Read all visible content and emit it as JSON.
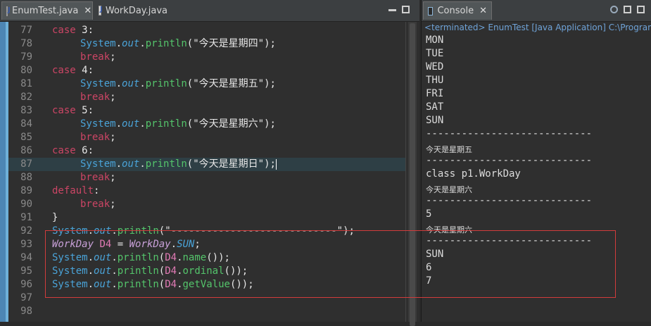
{
  "editor": {
    "tabs": [
      {
        "label": "EnumTest.java",
        "active": true
      },
      {
        "label": "WorkDay.java",
        "active": false
      }
    ],
    "close_glyph": "✕",
    "lines": [
      {
        "n": "77",
        "parts": [
          [
            "kw",
            "case"
          ],
          [
            "num",
            " 3"
          ],
          [
            "",
            ":"
          ]
        ],
        "indent": 1
      },
      {
        "n": "78",
        "parts": [
          [
            "cls",
            "System"
          ],
          [
            "",
            "."
          ],
          [
            "fld",
            "out"
          ],
          [
            "",
            "."
          ],
          [
            "mth",
            "println"
          ],
          [
            "",
            "("
          ],
          [
            "str",
            "\"今天是星期四\""
          ],
          [
            "",
            ");"
          ]
        ],
        "indent": 2
      },
      {
        "n": "79",
        "parts": [
          [
            "kw",
            "break"
          ],
          [
            "",
            ";"
          ]
        ],
        "indent": 2
      },
      {
        "n": "80",
        "parts": [
          [
            "kw",
            "case"
          ],
          [
            "num",
            " 4"
          ],
          [
            "",
            ":"
          ]
        ],
        "indent": 1
      },
      {
        "n": "81",
        "parts": [
          [
            "cls",
            "System"
          ],
          [
            "",
            "."
          ],
          [
            "fld",
            "out"
          ],
          [
            "",
            "."
          ],
          [
            "mth",
            "println"
          ],
          [
            "",
            "("
          ],
          [
            "str",
            "\"今天是星期五\""
          ],
          [
            "",
            ");"
          ]
        ],
        "indent": 2
      },
      {
        "n": "82",
        "parts": [
          [
            "kw",
            "break"
          ],
          [
            "",
            ";"
          ]
        ],
        "indent": 2
      },
      {
        "n": "83",
        "parts": [
          [
            "kw",
            "case"
          ],
          [
            "num",
            " 5"
          ],
          [
            "",
            ":"
          ]
        ],
        "indent": 1
      },
      {
        "n": "84",
        "parts": [
          [
            "cls",
            "System"
          ],
          [
            "",
            "."
          ],
          [
            "fld",
            "out"
          ],
          [
            "",
            "."
          ],
          [
            "mth",
            "println"
          ],
          [
            "",
            "("
          ],
          [
            "str",
            "\"今天是星期六\""
          ],
          [
            "",
            ");"
          ]
        ],
        "indent": 2
      },
      {
        "n": "85",
        "parts": [
          [
            "kw",
            "break"
          ],
          [
            "",
            ";"
          ]
        ],
        "indent": 2
      },
      {
        "n": "86",
        "parts": [
          [
            "kw",
            "case"
          ],
          [
            "num",
            " 6"
          ],
          [
            "",
            ":"
          ]
        ],
        "indent": 1
      },
      {
        "n": "87",
        "parts": [
          [
            "cls",
            "System"
          ],
          [
            "",
            "."
          ],
          [
            "fld",
            "out"
          ],
          [
            "",
            "."
          ],
          [
            "mth",
            "println"
          ],
          [
            "",
            "("
          ],
          [
            "str",
            "\"今天是星期日\""
          ],
          [
            "",
            ");"
          ]
        ],
        "indent": 2,
        "current": true
      },
      {
        "n": "88",
        "parts": [
          [
            "kw",
            "break"
          ],
          [
            "",
            ";"
          ]
        ],
        "indent": 2
      },
      {
        "n": "89",
        "parts": [
          [
            "kw",
            "default"
          ],
          [
            "",
            ":"
          ]
        ],
        "indent": 1
      },
      {
        "n": "90",
        "parts": [
          [
            "kw",
            "break"
          ],
          [
            "",
            ";"
          ]
        ],
        "indent": 2
      },
      {
        "n": "91",
        "parts": [
          [
            "",
            "}"
          ]
        ],
        "indent": 1
      },
      {
        "n": "92",
        "parts": [
          [
            "cls",
            "System"
          ],
          [
            "",
            "."
          ],
          [
            "fld",
            "out"
          ],
          [
            "",
            "."
          ],
          [
            "mth",
            "println"
          ],
          [
            "",
            "("
          ],
          [
            "str",
            "\"----------------------------\""
          ],
          [
            "",
            ");"
          ]
        ],
        "indent": 1
      },
      {
        "n": "93",
        "parts": [
          [
            "typ",
            "WorkDay"
          ],
          [
            "",
            ""
          ],
          [
            "var",
            " D4"
          ],
          [
            "",
            " = "
          ],
          [
            "typ",
            "WorkDay"
          ],
          [
            "",
            "."
          ],
          [
            "fld",
            "SUN"
          ],
          [
            "",
            ";"
          ]
        ],
        "indent": 1
      },
      {
        "n": "94",
        "parts": [
          [
            "cls",
            "System"
          ],
          [
            "",
            "."
          ],
          [
            "fld",
            "out"
          ],
          [
            "",
            "."
          ],
          [
            "mth",
            "println"
          ],
          [
            "",
            "("
          ],
          [
            "var",
            "D4"
          ],
          [
            "",
            "."
          ],
          [
            "mth",
            "name"
          ],
          [
            "",
            "());"
          ]
        ],
        "indent": 1
      },
      {
        "n": "95",
        "parts": [
          [
            "cls",
            "System"
          ],
          [
            "",
            "."
          ],
          [
            "fld",
            "out"
          ],
          [
            "",
            "."
          ],
          [
            "mth",
            "println"
          ],
          [
            "",
            "("
          ],
          [
            "var",
            "D4"
          ],
          [
            "",
            "."
          ],
          [
            "mth",
            "ordinal"
          ],
          [
            "",
            "());"
          ]
        ],
        "indent": 1
      },
      {
        "n": "96",
        "parts": [
          [
            "cls",
            "System"
          ],
          [
            "",
            "."
          ],
          [
            "fld",
            "out"
          ],
          [
            "",
            "."
          ],
          [
            "mth",
            "println"
          ],
          [
            "",
            "("
          ],
          [
            "var",
            "D4"
          ],
          [
            "",
            "."
          ],
          [
            "mth",
            "getValue"
          ],
          [
            "",
            "());"
          ]
        ],
        "indent": 1
      },
      {
        "n": "97",
        "parts": [],
        "indent": 0
      },
      {
        "n": "98",
        "parts": [],
        "indent": 0
      }
    ]
  },
  "console": {
    "tab_label": "Console",
    "close_glyph": "✕",
    "terminated_text": "<terminated> EnumTest [Java Application] C:\\Program",
    "output": [
      {
        "text": "MON",
        "cjk": false
      },
      {
        "text": "TUE",
        "cjk": false
      },
      {
        "text": "WED",
        "cjk": false
      },
      {
        "text": "THU",
        "cjk": false
      },
      {
        "text": "FRI",
        "cjk": false
      },
      {
        "text": "SAT",
        "cjk": false
      },
      {
        "text": "SUN",
        "cjk": false
      },
      {
        "text": "----------------------------",
        "cjk": false
      },
      {
        "text": "今天是星期五",
        "cjk": true
      },
      {
        "text": "----------------------------",
        "cjk": false
      },
      {
        "text": "class p1.WorkDay",
        "cjk": false
      },
      {
        "text": "今天是星期六",
        "cjk": true
      },
      {
        "text": "----------------------------",
        "cjk": false
      },
      {
        "text": "5",
        "cjk": false
      },
      {
        "text": "今天是星期六",
        "cjk": true
      },
      {
        "text": "----------------------------",
        "cjk": false
      },
      {
        "text": "SUN",
        "cjk": false
      },
      {
        "text": "6",
        "cjk": false
      },
      {
        "text": "7",
        "cjk": false
      }
    ]
  },
  "colors": {
    "keyword": "#cc4565",
    "class": "#4aa3d8",
    "method": "#54c46b",
    "highlight_box": "#d23c3c",
    "terminated": "#6fa3d8"
  },
  "icons": {
    "java_file": "java-file-icon",
    "console": "console-icon",
    "minimize": "minimize-icon",
    "maximize": "maximize-icon",
    "pin": "pin-console-icon"
  }
}
